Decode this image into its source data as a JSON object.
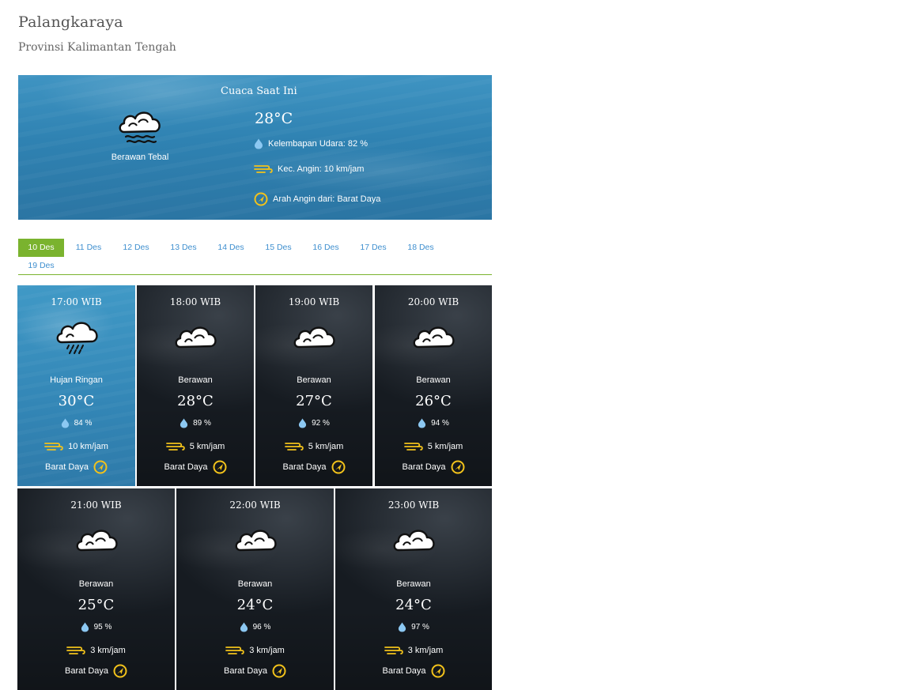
{
  "location": {
    "city": "Palangkaraya",
    "province": "Provinsi Kalimantan Tengah"
  },
  "current": {
    "heading": "Cuaca Saat Ini",
    "condition": "Berawan Tebal",
    "condition_icon": "thick-cloud-icon",
    "temperature": "28°C",
    "humidity": "Kelembapan Udara: 82 %",
    "wind_speed": "Kec. Angin: 10 km/jam",
    "wind_direction": "Arah Angin dari: Barat Daya"
  },
  "colors": {
    "accent_green": "#7ab32e",
    "tab_link_blue": "#3f8fcf",
    "wind_yellow": "#f2c21b",
    "humidity_blue": "#8cc8f2"
  },
  "tabs": [
    {
      "label": "10 Des",
      "active": true
    },
    {
      "label": "11 Des",
      "active": false
    },
    {
      "label": "12 Des",
      "active": false
    },
    {
      "label": "13 Des",
      "active": false
    },
    {
      "label": "14 Des",
      "active": false
    },
    {
      "label": "15 Des",
      "active": false
    },
    {
      "label": "16 Des",
      "active": false
    },
    {
      "label": "17 Des",
      "active": false
    },
    {
      "label": "18 Des",
      "active": false
    },
    {
      "label": "19 Des",
      "active": false
    }
  ],
  "forecast": [
    {
      "time": "17:00 WIB",
      "condition": "Hujan Ringan",
      "icon": "rain-cloud-icon",
      "temperature": "30°C",
      "humidity": "84 %",
      "wind": "10 km/jam",
      "direction": "Barat Daya"
    },
    {
      "time": "18:00 WIB",
      "condition": "Berawan",
      "icon": "cloud-icon",
      "temperature": "28°C",
      "humidity": "89 %",
      "wind": "5 km/jam",
      "direction": "Barat Daya"
    },
    {
      "time": "19:00 WIB",
      "condition": "Berawan",
      "icon": "cloud-icon",
      "temperature": "27°C",
      "humidity": "92 %",
      "wind": "5 km/jam",
      "direction": "Barat Daya"
    },
    {
      "time": "20:00 WIB",
      "condition": "Berawan",
      "icon": "cloud-icon",
      "temperature": "26°C",
      "humidity": "94 %",
      "wind": "5 km/jam",
      "direction": "Barat Daya"
    },
    {
      "time": "21:00 WIB",
      "condition": "Berawan",
      "icon": "cloud-icon",
      "temperature": "25°C",
      "humidity": "95 %",
      "wind": "3 km/jam",
      "direction": "Barat Daya"
    },
    {
      "time": "22:00 WIB",
      "condition": "Berawan",
      "icon": "cloud-icon",
      "temperature": "24°C",
      "humidity": "96 %",
      "wind": "3 km/jam",
      "direction": "Barat Daya"
    },
    {
      "time": "23:00 WIB",
      "condition": "Berawan",
      "icon": "cloud-icon",
      "temperature": "24°C",
      "humidity": "97 %",
      "wind": "3 km/jam",
      "direction": "Barat Daya"
    }
  ]
}
